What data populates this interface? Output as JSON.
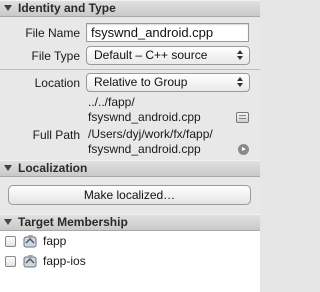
{
  "identity": {
    "title": "Identity and Type",
    "file_name_label": "File Name",
    "file_name_value": "fsyswnd_android.cpp",
    "file_type_label": "File Type",
    "file_type_value": "Default – C++ source",
    "location_label": "Location",
    "location_value": "Relative to Group",
    "relative_path_line1": "../../fapp/",
    "relative_path_line2": "fsyswnd_android.cpp",
    "full_path_label": "Full Path",
    "full_path_line1": "/Users/dyj/work/fx/fapp/",
    "full_path_line2": "fsyswnd_android.cpp"
  },
  "localization": {
    "title": "Localization",
    "button_label": "Make localized…"
  },
  "membership": {
    "title": "Target Membership",
    "targets": [
      {
        "name": "fapp",
        "checked": false
      },
      {
        "name": "fapp-ios",
        "checked": false
      }
    ]
  }
}
